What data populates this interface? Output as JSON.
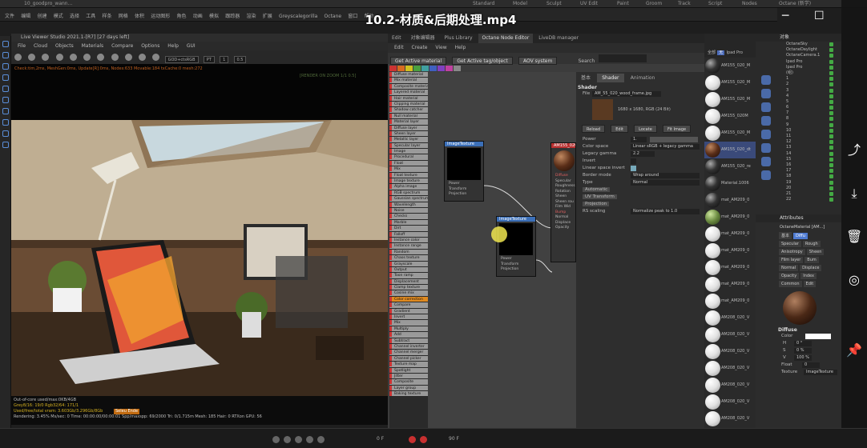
{
  "video_title": "10.2-材质&后期处理.mp4",
  "top_tabs": [
    "10_goodpro_wann...",
    "Standard",
    "Model",
    "Sculpt",
    "UV Edit",
    "Paint",
    "Groom",
    "Track",
    "Script",
    "Nodes",
    "Octane (新学)"
  ],
  "menu": [
    "文件",
    "编辑",
    "创建",
    "模式",
    "选择",
    "工具",
    "样条",
    "网格",
    "体积",
    "运动图形",
    "角色",
    "动画",
    "模拟",
    "跟踪器",
    "渲染",
    "扩展",
    "Greyscalegorilla",
    "Octane",
    "窗口",
    "帮助"
  ],
  "live_viewer": {
    "title": "Live Viewer Studio 2021.1-[R7] [27 days left]",
    "menu": [
      "File",
      "Cloud",
      "Objects",
      "Materials",
      "Compare",
      "Options",
      "Help",
      "GUI"
    ],
    "mode_box": "GOD+ctsRGB",
    "pt_box": "PT",
    "num_box": "1",
    "zoom_box": "0.5",
    "status_line": "Check:tim,2ms, MeshGen:0ms, Update[R]:0ms, Nodes:633 Movable:184 txCache:0 mesh:272",
    "status_line2": "[RENDER ON ZOOM 1/1 0.5]",
    "stats": [
      "Out-of-core used/max:0KB/4GB",
      "Grey8/16: 19/0          Rgb32/64: 171/1",
      "Used/free/total vram: 3.603Gb/3.296Gb/8Gb",
      "Rendering: 3.45%   Ms/sec: 0   Time: 00:00:00/00:00:01   Spp/maxspp: 69/2000   Tri: 0/1.715m   Mesh: 185   Hair: 0   RTXon   GPU: 56"
    ],
    "stats_tag": "Seleu Ende"
  },
  "node_editor": {
    "tabs": [
      "Edit",
      "对象编辑器",
      "Plus Library",
      "Octane Node Editor",
      "LiveDB manager"
    ],
    "active_tab": "Octane Node Editor",
    "menu": [
      "Edit",
      "Create",
      "View",
      "Help"
    ],
    "buttons": [
      "Get Active material",
      "Get Active tag/object",
      "AOV system"
    ],
    "search_label": "Search",
    "color_tabs": [
      "Mat",
      "Tex",
      "Gen",
      "Map",
      "Pb",
      "Vtx",
      "Em",
      "Med",
      "C4D"
    ],
    "node_list": [
      "Diffuse material",
      "Mix material",
      "Composite material",
      "Layered material",
      "Hair material",
      "Clipping material",
      "Shadow catcher",
      "Null material",
      "Material layer",
      "Diffuse layer",
      "Sheen layer",
      "Metallic layer",
      "Specular layer",
      "Image",
      "Procedural",
      "Float",
      "Mix",
      "Float texture",
      "Image texture",
      "Alpha image",
      "RGB spectrum",
      "Gaussian spectrum",
      "Wavelength",
      "Noise",
      "Checks",
      "Marble",
      "Dirt",
      "Falloff",
      "Instance color",
      "Instance range",
      "Random",
      "Chaos texture",
      "Grayscale",
      "Output",
      "Toon ramp",
      "Displacement",
      "Clamp texture",
      "Cosine mix",
      "Color correction",
      "Compare",
      "Gradient",
      "Invert",
      "Mix",
      "Multiply",
      "Add",
      "Subtract",
      "Channel inverter",
      "Channel merger",
      "Channel picker",
      "Texture map",
      "Spotlight",
      "Jitter",
      "Composite",
      "Layer group",
      "Baking texture"
    ],
    "node_list_highlight": "Color correction",
    "node1": {
      "title": "ImageTexture",
      "pins": [
        "Power",
        "Transform",
        "Projection"
      ]
    },
    "node2": {
      "title": "ImageTexture",
      "pins": [
        "Power",
        "Transform",
        "Projection"
      ]
    },
    "node3": {
      "title": "AM155_020",
      "pins": [
        "Diffuse",
        "Specular",
        "Roughness",
        "Rotation",
        "Sheen",
        "Sheen rou",
        "Film Wid",
        "Bump",
        "Normal",
        "Displace",
        "Opacity"
      ]
    }
  },
  "shader_panel": {
    "tabs": [
      "基本",
      "Shader",
      "Animation"
    ],
    "active_tab": "Shader",
    "heading": "Shader",
    "file_label": "File",
    "file_value": "AM_55_020_wood_frame.jpg",
    "image_info": "1680 x 1680, RGB (24 Bit)",
    "buttons": [
      "Reload",
      "Edit",
      "Locate",
      "Fit Image"
    ],
    "rows": [
      {
        "label": "Power",
        "value": "1."
      },
      {
        "label": "Color space",
        "value": "Linear sRGB + legacy gamma"
      },
      {
        "label": "Legacy gamma",
        "value": "2.2"
      },
      {
        "label": "Invert",
        "value": ""
      },
      {
        "label": "Linear space invert",
        "value": ""
      },
      {
        "label": "Border mode",
        "value": "Wrap around"
      },
      {
        "label": "Type",
        "value": "Normal"
      },
      {
        "label": "Automatic",
        "value": ""
      },
      {
        "label": "UV Transform",
        "value": ""
      },
      {
        "label": "Projection",
        "value": ""
      },
      {
        "label": "RS scaling",
        "value": "Normalize peak to 1.0"
      }
    ]
  },
  "material_list": {
    "header": [
      "全部",
      "无",
      "Ipad Pro"
    ],
    "items": [
      {
        "name": "AM155_020_M",
        "style": "dark"
      },
      {
        "name": "AM155_020_M",
        "style": "white"
      },
      {
        "name": "AM155_020_M",
        "style": "white"
      },
      {
        "name": "AM155_020M",
        "style": "white"
      },
      {
        "name": "AM155_020_M",
        "style": "white"
      },
      {
        "name": "AM155_020_dt",
        "style": "wood"
      },
      {
        "name": "AM155_020_re",
        "style": "dark"
      },
      {
        "name": "Material.1006",
        "style": "dark"
      },
      {
        "name": "mat_AM209_0",
        "style": "dark"
      },
      {
        "name": "mat_AM209_0",
        "style": "green"
      },
      {
        "name": "mat_AM209_0",
        "style": "white"
      },
      {
        "name": "mat_AM209_0",
        "style": "white"
      },
      {
        "name": "mat_AM209_0",
        "style": "white"
      },
      {
        "name": "mat_AM209_0",
        "style": "white"
      },
      {
        "name": "mat_AM209_0",
        "style": "white"
      },
      {
        "name": "AM208_020_V",
        "style": "white"
      },
      {
        "name": "AM208_020_V",
        "style": "white"
      },
      {
        "name": "AM208_020_V",
        "style": "white"
      },
      {
        "name": "AM208_020_V",
        "style": "white"
      },
      {
        "name": "AM208_020_V",
        "style": "white"
      },
      {
        "name": "AM208_020_V",
        "style": "white"
      },
      {
        "name": "AM208_020_V",
        "style": "white"
      }
    ],
    "selected_index": 5
  },
  "object_panel": {
    "title": "对象",
    "items": [
      "OctaneSky",
      "OctaneDaylight",
      "OctaneCamera.1",
      "Ipad Pro",
      "Ipad Pro",
      "(组)",
      "1",
      "2",
      "3",
      "4",
      "5",
      "6",
      "7",
      "8",
      "9",
      "10",
      "11",
      "12",
      "13",
      "14",
      "15",
      "16",
      "17",
      "18",
      "19",
      "20",
      "21",
      "22"
    ]
  },
  "attributes": {
    "title": "Attributes",
    "material_name": "OctaneMaterial [AM...]",
    "tabs": [
      "基本",
      "Diffu",
      "Specular",
      "Rough",
      "Anisotropy",
      "Sheen",
      "Film layer",
      "Bum",
      "Normal",
      "Displace",
      "Opacity",
      "Index",
      "Common",
      "Edit"
    ],
    "active_tab": "Diffu",
    "section": "Diffuse",
    "color_label": "Color",
    "h_label": "H",
    "h_val": "0 °",
    "s_label": "S",
    "s_val": "0 %",
    "v_label": "V",
    "v_val": "100 %",
    "float_label": "Float",
    "float_val": "0",
    "texture_label": "Texture",
    "texture_val": "ImageTexture"
  },
  "timeline": {
    "frame": "0 F",
    "end": "90 F"
  },
  "colors": {
    "accent": "#3b6fb8",
    "highlight": "#e08a20"
  }
}
